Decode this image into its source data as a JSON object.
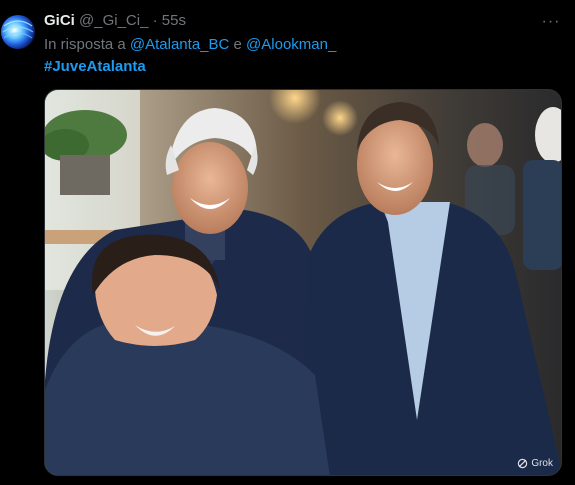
{
  "tweet": {
    "display_name": "GiCi",
    "handle": "@_Gi_Ci_",
    "separator": "·",
    "timestamp": "55s",
    "more_glyph": "···",
    "reply_prefix": "In risposta a",
    "reply_mention_1": "@Atalanta_BC",
    "reply_and": "e",
    "reply_mention_2": "@Alookman_",
    "hashtag": "#JuveAtalanta"
  },
  "media": {
    "badge_icon": "grok-icon",
    "badge_label": "Grok"
  },
  "colors": {
    "background": "#000000",
    "text": "#e7e9ea",
    "secondary": "#71767b",
    "link": "#1d9bf0"
  }
}
